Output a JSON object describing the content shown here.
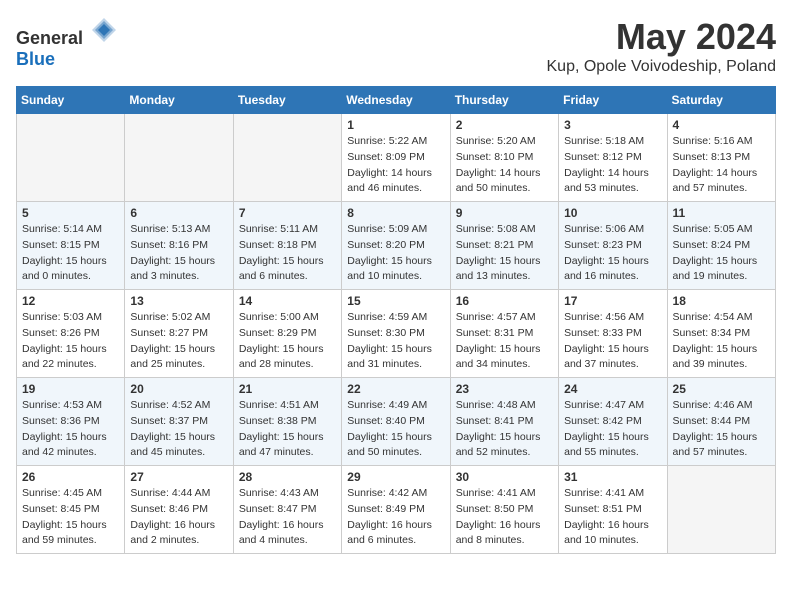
{
  "header": {
    "logo_general": "General",
    "logo_blue": "Blue",
    "month": "May 2024",
    "location": "Kup, Opole Voivodeship, Poland"
  },
  "weekdays": [
    "Sunday",
    "Monday",
    "Tuesday",
    "Wednesday",
    "Thursday",
    "Friday",
    "Saturday"
  ],
  "weeks": [
    [
      {
        "day": "",
        "empty": true
      },
      {
        "day": "",
        "empty": true
      },
      {
        "day": "",
        "empty": true
      },
      {
        "day": "1",
        "sunrise": "5:22 AM",
        "sunset": "8:09 PM",
        "daylight": "14 hours and 46 minutes."
      },
      {
        "day": "2",
        "sunrise": "5:20 AM",
        "sunset": "8:10 PM",
        "daylight": "14 hours and 50 minutes."
      },
      {
        "day": "3",
        "sunrise": "5:18 AM",
        "sunset": "8:12 PM",
        "daylight": "14 hours and 53 minutes."
      },
      {
        "day": "4",
        "sunrise": "5:16 AM",
        "sunset": "8:13 PM",
        "daylight": "14 hours and 57 minutes."
      }
    ],
    [
      {
        "day": "5",
        "sunrise": "5:14 AM",
        "sunset": "8:15 PM",
        "daylight": "15 hours and 0 minutes."
      },
      {
        "day": "6",
        "sunrise": "5:13 AM",
        "sunset": "8:16 PM",
        "daylight": "15 hours and 3 minutes."
      },
      {
        "day": "7",
        "sunrise": "5:11 AM",
        "sunset": "8:18 PM",
        "daylight": "15 hours and 6 minutes."
      },
      {
        "day": "8",
        "sunrise": "5:09 AM",
        "sunset": "8:20 PM",
        "daylight": "15 hours and 10 minutes."
      },
      {
        "day": "9",
        "sunrise": "5:08 AM",
        "sunset": "8:21 PM",
        "daylight": "15 hours and 13 minutes."
      },
      {
        "day": "10",
        "sunrise": "5:06 AM",
        "sunset": "8:23 PM",
        "daylight": "15 hours and 16 minutes."
      },
      {
        "day": "11",
        "sunrise": "5:05 AM",
        "sunset": "8:24 PM",
        "daylight": "15 hours and 19 minutes."
      }
    ],
    [
      {
        "day": "12",
        "sunrise": "5:03 AM",
        "sunset": "8:26 PM",
        "daylight": "15 hours and 22 minutes."
      },
      {
        "day": "13",
        "sunrise": "5:02 AM",
        "sunset": "8:27 PM",
        "daylight": "15 hours and 25 minutes."
      },
      {
        "day": "14",
        "sunrise": "5:00 AM",
        "sunset": "8:29 PM",
        "daylight": "15 hours and 28 minutes."
      },
      {
        "day": "15",
        "sunrise": "4:59 AM",
        "sunset": "8:30 PM",
        "daylight": "15 hours and 31 minutes."
      },
      {
        "day": "16",
        "sunrise": "4:57 AM",
        "sunset": "8:31 PM",
        "daylight": "15 hours and 34 minutes."
      },
      {
        "day": "17",
        "sunrise": "4:56 AM",
        "sunset": "8:33 PM",
        "daylight": "15 hours and 37 minutes."
      },
      {
        "day": "18",
        "sunrise": "4:54 AM",
        "sunset": "8:34 PM",
        "daylight": "15 hours and 39 minutes."
      }
    ],
    [
      {
        "day": "19",
        "sunrise": "4:53 AM",
        "sunset": "8:36 PM",
        "daylight": "15 hours and 42 minutes."
      },
      {
        "day": "20",
        "sunrise": "4:52 AM",
        "sunset": "8:37 PM",
        "daylight": "15 hours and 45 minutes."
      },
      {
        "day": "21",
        "sunrise": "4:51 AM",
        "sunset": "8:38 PM",
        "daylight": "15 hours and 47 minutes."
      },
      {
        "day": "22",
        "sunrise": "4:49 AM",
        "sunset": "8:40 PM",
        "daylight": "15 hours and 50 minutes."
      },
      {
        "day": "23",
        "sunrise": "4:48 AM",
        "sunset": "8:41 PM",
        "daylight": "15 hours and 52 minutes."
      },
      {
        "day": "24",
        "sunrise": "4:47 AM",
        "sunset": "8:42 PM",
        "daylight": "15 hours and 55 minutes."
      },
      {
        "day": "25",
        "sunrise": "4:46 AM",
        "sunset": "8:44 PM",
        "daylight": "15 hours and 57 minutes."
      }
    ],
    [
      {
        "day": "26",
        "sunrise": "4:45 AM",
        "sunset": "8:45 PM",
        "daylight": "15 hours and 59 minutes."
      },
      {
        "day": "27",
        "sunrise": "4:44 AM",
        "sunset": "8:46 PM",
        "daylight": "16 hours and 2 minutes."
      },
      {
        "day": "28",
        "sunrise": "4:43 AM",
        "sunset": "8:47 PM",
        "daylight": "16 hours and 4 minutes."
      },
      {
        "day": "29",
        "sunrise": "4:42 AM",
        "sunset": "8:49 PM",
        "daylight": "16 hours and 6 minutes."
      },
      {
        "day": "30",
        "sunrise": "4:41 AM",
        "sunset": "8:50 PM",
        "daylight": "16 hours and 8 minutes."
      },
      {
        "day": "31",
        "sunrise": "4:41 AM",
        "sunset": "8:51 PM",
        "daylight": "16 hours and 10 minutes."
      },
      {
        "day": "",
        "empty": true
      }
    ]
  ]
}
